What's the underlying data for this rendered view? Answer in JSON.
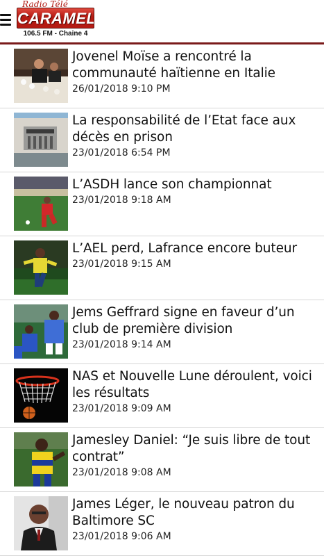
{
  "header": {
    "menu_icon": "hamburger-menu-icon",
    "logo": {
      "top_text": "Radio Télé",
      "word": "CARAMEL",
      "sub_text": "106.5 FM - Chaine 4"
    },
    "colors": {
      "brand": "#b51b13",
      "rule": "#7a1a1a"
    }
  },
  "articles": [
    {
      "title": "Jovenel Moïse a rencontré la communauté haïtienne en Italie",
      "date": "26/01/2018 9:10 PM"
    },
    {
      "title": "La responsabilité de l’Etat face aux décès en prison",
      "date": "23/01/2018 6:54 PM"
    },
    {
      "title": "L’ASDH lance son championnat",
      "date": "23/01/2018 9:18 AM"
    },
    {
      "title": "L’AEL perd, Lafrance encore buteur",
      "date": "23/01/2018 9:15 AM"
    },
    {
      "title": "Jems Geffrard signe en faveur d’un club de première division",
      "date": "23/01/2018 9:14 AM"
    },
    {
      "title": "NAS et Nouvelle Lune déroulent, voici les résultats",
      "date": "23/01/2018 9:09 AM"
    },
    {
      "title": "Jamesley Daniel: “Je suis libre de tout contrat”",
      "date": "23/01/2018 9:08 AM"
    },
    {
      "title": "James Léger, le nouveau patron du Baltimore SC",
      "date": "23/01/2018 9:06 AM"
    }
  ]
}
